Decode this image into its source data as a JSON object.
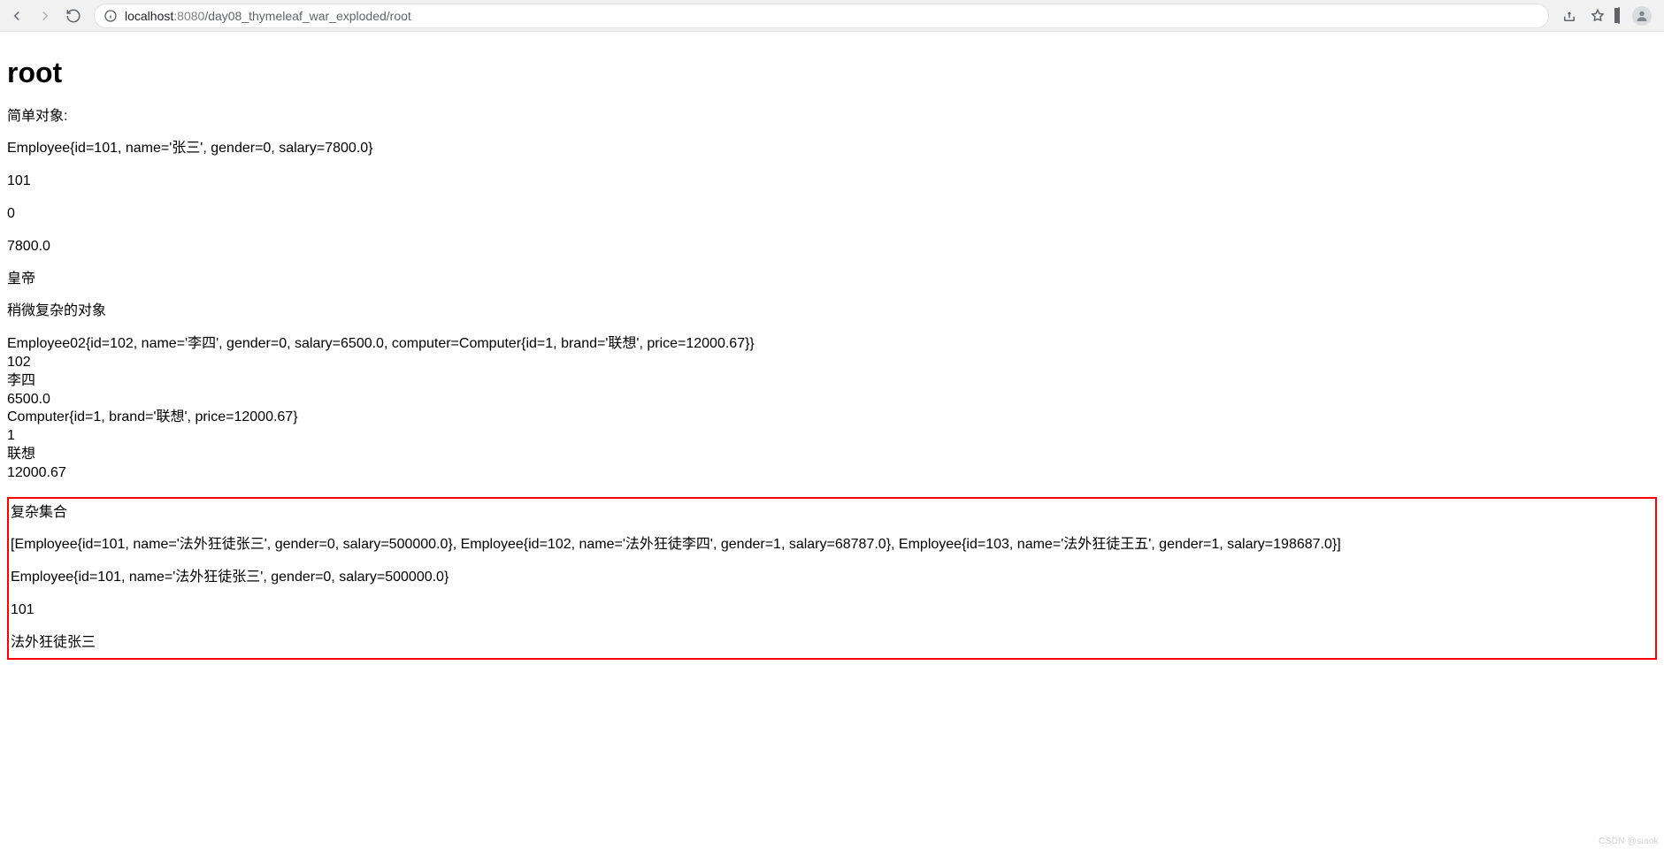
{
  "browser": {
    "url_host": "localhost",
    "url_port": ":8080",
    "url_path": "/day08_thymeleaf_war_exploded/root"
  },
  "page": {
    "title": "root",
    "label_simple": "简单对象:",
    "emp1_tostring": "Employee{id=101, name='张三', gender=0, salary=7800.0}",
    "emp1_id": "101",
    "emp1_gender": "0",
    "emp1_salary": "7800.0",
    "emperor": "皇帝",
    "label_complex_obj": "稍微复杂的对象",
    "emp2_tostring": "Employee02{id=102, name='李四', gender=0, salary=6500.0, computer=Computer{id=1, brand='联想', price=12000.67}}",
    "emp2_id": "102",
    "emp2_name": "李四",
    "emp2_salary": "6500.0",
    "computer_tostring": "Computer{id=1, brand='联想', price=12000.67}",
    "computer_id": "1",
    "computer_brand": "联想",
    "computer_price": "12000.67",
    "label_collection": "复杂集合",
    "emp_list_tostring": "[Employee{id=101, name='法外狂徒张三', gender=0, salary=500000.0}, Employee{id=102, name='法外狂徒李四', gender=1, salary=68787.0}, Employee{id=103, name='法外狂徒王五', gender=1, salary=198687.0}]",
    "list0_tostring": "Employee{id=101, name='法外狂徒张三', gender=0, salary=500000.0}",
    "list0_id": "101",
    "list0_name": "法外狂徒张三"
  },
  "watermark": "CSDN @siaok"
}
